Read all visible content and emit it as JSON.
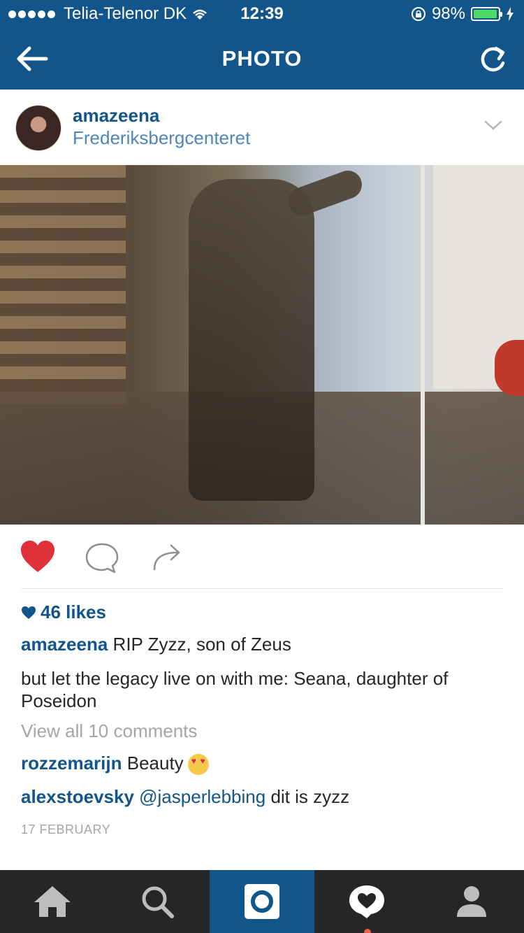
{
  "status_bar": {
    "carrier": "Telia-Telenor DK",
    "time": "12:39",
    "battery": "98%",
    "battery_level": 0.98
  },
  "nav": {
    "title": "PHOTO"
  },
  "post": {
    "username": "amazeena",
    "location": "Frederiksbergcenteret",
    "likes": "46 likes",
    "caption_user": "amazeena",
    "caption_text": "RIP Zyzz, son of Zeus",
    "caption_text_2": "but let the legacy live on with me: Seana, daughter of Poseidon",
    "view_all": "View all 10 comments",
    "comments": [
      {
        "user": "rozzemarijn",
        "text": "Beauty"
      },
      {
        "user": "alexstoevsky",
        "mention": "@jasperlebbing",
        "text": "dit is zyzz"
      }
    ],
    "date": "17 FEBRUARY"
  },
  "colors": {
    "brand": "#12558a",
    "heart": "#e0303a",
    "tabbar": "#262626"
  },
  "icons": {
    "back": "back-arrow-icon",
    "refresh": "refresh-icon",
    "like": "heart-icon",
    "comment": "comment-icon",
    "share": "share-icon",
    "tabs": [
      "home-icon",
      "search-icon",
      "camera-icon",
      "activity-icon",
      "profile-icon"
    ]
  }
}
